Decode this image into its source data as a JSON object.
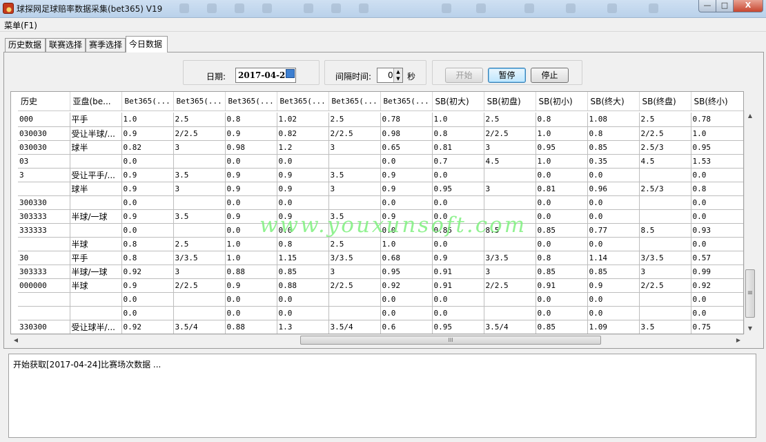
{
  "window": {
    "title": "球探网足球赔率数据采集(bet365) V19",
    "controls": {
      "minimize": "—",
      "maximize": "□",
      "close": "X"
    }
  },
  "menu": {
    "items": [
      "菜单(F1)"
    ]
  },
  "tabs": [
    {
      "label": "历史数据",
      "active": false
    },
    {
      "label": "联赛选择",
      "active": false
    },
    {
      "label": "赛季选择",
      "active": false
    },
    {
      "label": "今日数据",
      "active": true
    }
  ],
  "controls": {
    "date_label": "日期:",
    "date_value": "2017-04-24",
    "interval_label": "间隔时间:",
    "interval_value": "0",
    "interval_unit": "秒",
    "start_button": "开始",
    "pause_button": "暂停",
    "stop_button": "停止"
  },
  "grid": {
    "columns": [
      "历史",
      "亚盘(be...",
      "Bet365(...",
      "Bet365(...",
      "Bet365(...",
      "Bet365(...",
      "Bet365(...",
      "Bet365(...",
      "SB(初大)",
      "SB(初盘)",
      "SB(初小)",
      "SB(终大)",
      "SB(终盘)",
      "SB(终小)"
    ],
    "rows": [
      [
        "000",
        "平手",
        "1.0",
        "2.5",
        "0.8",
        "1.02",
        "2.5",
        "0.78",
        "1.0",
        "2.5",
        "0.8",
        "1.08",
        "2.5",
        "0.78"
      ],
      [
        "030030",
        "受让半球/...",
        "0.9",
        "2/2.5",
        "0.9",
        "0.82",
        "2/2.5",
        "0.98",
        "0.8",
        "2/2.5",
        "1.0",
        "0.8",
        "2/2.5",
        "1.0"
      ],
      [
        "030030",
        "球半",
        "0.82",
        "3",
        "0.98",
        "1.2",
        "3",
        "0.65",
        "0.81",
        "3",
        "0.95",
        "0.85",
        "2.5/3",
        "0.95"
      ],
      [
        "03",
        "",
        "0.0",
        "",
        "0.0",
        "0.0",
        "",
        "0.0",
        "0.7",
        "4.5",
        "1.0",
        "0.35",
        "4.5",
        "1.53"
      ],
      [
        "3",
        "受让平手/...",
        "0.9",
        "3.5",
        "0.9",
        "0.9",
        "3.5",
        "0.9",
        "0.0",
        "",
        "0.0",
        "0.0",
        "",
        "0.0"
      ],
      [
        "",
        "球半",
        "0.9",
        "3",
        "0.9",
        "0.9",
        "3",
        "0.9",
        "0.95",
        "3",
        "0.81",
        "0.96",
        "2.5/3",
        "0.8"
      ],
      [
        "300330",
        "",
        "0.0",
        "",
        "0.0",
        "0.0",
        "",
        "0.0",
        "0.0",
        "",
        "0.0",
        "0.0",
        "",
        "0.0"
      ],
      [
        "303333",
        "半球/一球",
        "0.9",
        "3.5",
        "0.9",
        "0.9",
        "3.5",
        "0.9",
        "0.0",
        "",
        "0.0",
        "0.0",
        "",
        "0.0"
      ],
      [
        "333333",
        "",
        "0.0",
        "",
        "0.0",
        "0.0",
        "",
        "0.0",
        "0.85",
        "8.5",
        "0.85",
        "0.77",
        "8.5",
        "0.93"
      ],
      [
        "",
        "半球",
        "0.8",
        "2.5",
        "1.0",
        "0.8",
        "2.5",
        "1.0",
        "0.0",
        "",
        "0.0",
        "0.0",
        "",
        "0.0"
      ],
      [
        "30",
        "平手",
        "0.8",
        "3/3.5",
        "1.0",
        "1.15",
        "3/3.5",
        "0.68",
        "0.9",
        "3/3.5",
        "0.8",
        "1.14",
        "3/3.5",
        "0.57"
      ],
      [
        "303333",
        "半球/一球",
        "0.92",
        "3",
        "0.88",
        "0.85",
        "3",
        "0.95",
        "0.91",
        "3",
        "0.85",
        "0.85",
        "3",
        "0.99"
      ],
      [
        "000000",
        "半球",
        "0.9",
        "2/2.5",
        "0.9",
        "0.88",
        "2/2.5",
        "0.92",
        "0.91",
        "2/2.5",
        "0.91",
        "0.9",
        "2/2.5",
        "0.92"
      ],
      [
        "",
        "",
        "0.0",
        "",
        "0.0",
        "0.0",
        "",
        "0.0",
        "0.0",
        "",
        "0.0",
        "0.0",
        "",
        "0.0"
      ],
      [
        "",
        "",
        "0.0",
        "",
        "0.0",
        "0.0",
        "",
        "0.0",
        "0.0",
        "",
        "0.0",
        "0.0",
        "",
        "0.0"
      ],
      [
        "330300",
        "受让球半/...",
        "0.92",
        "3.5/4",
        "0.88",
        "1.3",
        "3.5/4",
        "0.6",
        "0.95",
        "3.5/4",
        "0.85",
        "1.09",
        "3.5",
        "0.75"
      ]
    ]
  },
  "scrollbars": {
    "vertical_grip": "≡",
    "horizontal_grip": "III",
    "up": "▲",
    "down": "▼",
    "left": "◀",
    "right": "▶"
  },
  "watermark": "www.youxunsoft.com",
  "log": {
    "lines": [
      "开始获取[2017-04-24]比赛场次数据 ..."
    ]
  }
}
